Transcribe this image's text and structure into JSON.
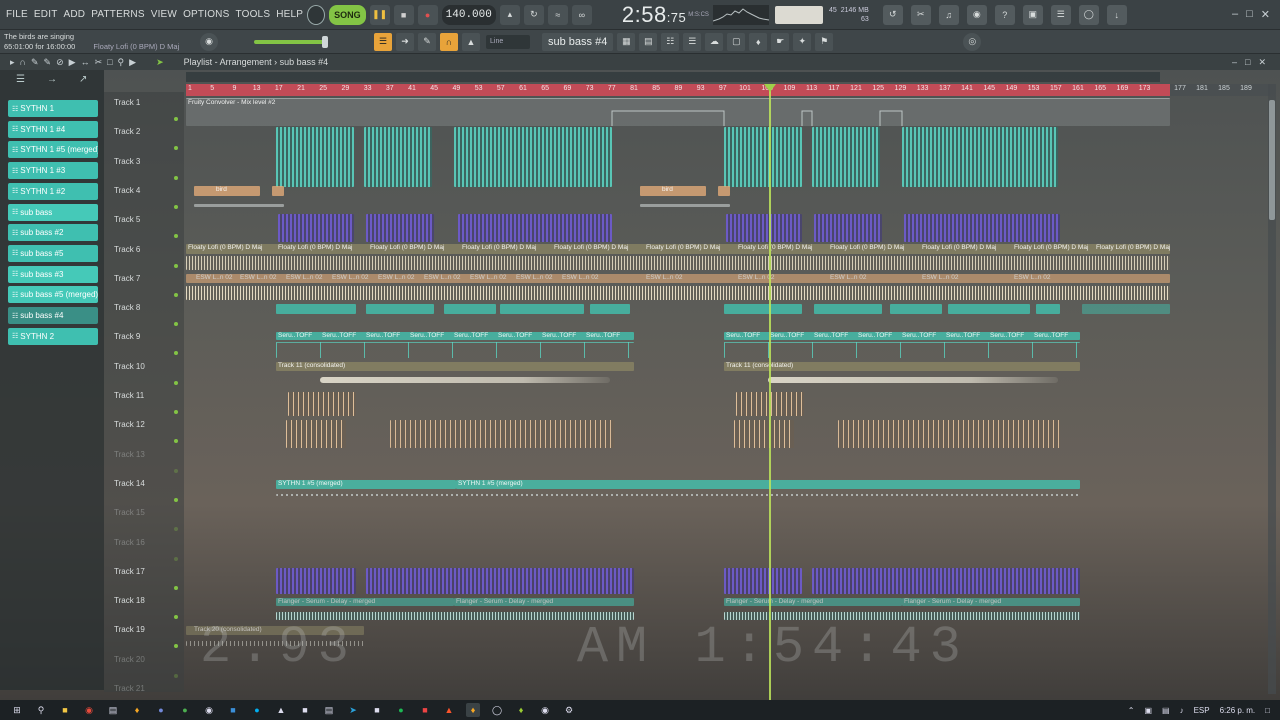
{
  "menu": [
    "FILE",
    "EDIT",
    "ADD",
    "PATTERNS",
    "VIEW",
    "OPTIONS",
    "TOOLS",
    "HELP"
  ],
  "transport": {
    "mode": "SONG",
    "tempo": "140.000",
    "time_main": "2:58",
    "time_sub": ":75",
    "time_unit": "M:S:CS",
    "memory": "2146 MB",
    "cpu_val": "45",
    "poly": "63"
  },
  "hint": {
    "line1": "The birds are singing",
    "line2": "65:01:00 for 16:00:00",
    "line3": "Floaty Lofi (0 BPM) D Maj"
  },
  "snap": "Line",
  "pattern_selector": "sub bass #4",
  "playlist": {
    "title": "Playlist - Arrangement › sub bass #4"
  },
  "patterns": [
    {
      "label": "SYTHN 1",
      "color": "#3fbfb0"
    },
    {
      "label": "SYTHN 1 #4",
      "color": "#3fbfb0"
    },
    {
      "label": "SYTHN 1 #5 (merged)",
      "color": "#3fbfb0"
    },
    {
      "label": "SYTHN 1 #3",
      "color": "#3fbfb0"
    },
    {
      "label": "SYTHN 1 #2",
      "color": "#3fbfb0"
    },
    {
      "label": "sub bass",
      "color": "#45c9b8"
    },
    {
      "label": "sub bass #2",
      "color": "#3fbfb0"
    },
    {
      "label": "sub bass #5",
      "color": "#3fbfb0"
    },
    {
      "label": "sub bass #3",
      "color": "#45c9b8"
    },
    {
      "label": "sub bass #5 (merged)",
      "color": "#45c9b8"
    },
    {
      "label": "sub bass #4",
      "color": "#3a8f86"
    },
    {
      "label": "SYTHN 2",
      "color": "#3fbfb0"
    }
  ],
  "tracks": [
    {
      "label": "Track 1",
      "muted": false
    },
    {
      "label": "Track 2",
      "muted": false
    },
    {
      "label": "Track 3",
      "muted": false
    },
    {
      "label": "Track 4",
      "muted": false
    },
    {
      "label": "Track 5",
      "muted": false
    },
    {
      "label": "Track 6",
      "muted": false
    },
    {
      "label": "Track 7",
      "muted": false
    },
    {
      "label": "Track 8",
      "muted": false
    },
    {
      "label": "Track 9",
      "muted": false
    },
    {
      "label": "Track 10",
      "muted": false
    },
    {
      "label": "Track 11",
      "muted": false
    },
    {
      "label": "Track 12",
      "muted": false
    },
    {
      "label": "Track 13",
      "muted": true
    },
    {
      "label": "Track 14",
      "muted": false
    },
    {
      "label": "Track 15",
      "muted": true
    },
    {
      "label": "Track 16",
      "muted": true
    },
    {
      "label": "Track 17",
      "muted": false
    },
    {
      "label": "Track 18",
      "muted": false
    },
    {
      "label": "Track 19",
      "muted": false
    },
    {
      "label": "Track 20",
      "muted": true
    },
    {
      "label": "Track 21",
      "muted": true
    }
  ],
  "ruler_ticks": [
    "1",
    "5",
    "9",
    "13",
    "17",
    "21",
    "25",
    "29",
    "33",
    "37",
    "41",
    "45",
    "49",
    "53",
    "57",
    "61",
    "65",
    "69",
    "73",
    "77",
    "81",
    "85",
    "89",
    "93",
    "97",
    "101",
    "105",
    "109",
    "113",
    "117",
    "121",
    "125",
    "129",
    "133",
    "137",
    "141",
    "145",
    "149",
    "153",
    "157",
    "161",
    "165",
    "169",
    "173"
  ],
  "ruler_ticks_ext": [
    "177",
    "181",
    "185",
    "189"
  ],
  "clip_labels": {
    "automation": "Fruity Convolver - Mix level #2",
    "bird": "bird",
    "floaty": "Floaty Lofi (0 BPM) D Maj",
    "esw": "ESW L..n 02",
    "serum": "Seru..TOFF",
    "track11": "Track 11 (consolidated)",
    "sythn_merged": "SYTHN 1 #5 (merged)",
    "flanger": "Flanger - Serum - Delay - merged",
    "track20": "Track 20 (consolidated)"
  },
  "overlay": {
    "left": "2.93",
    "right": "AM 1:54:43"
  },
  "taskbar": {
    "lang": "ESP",
    "time": "6:26 p. m."
  }
}
